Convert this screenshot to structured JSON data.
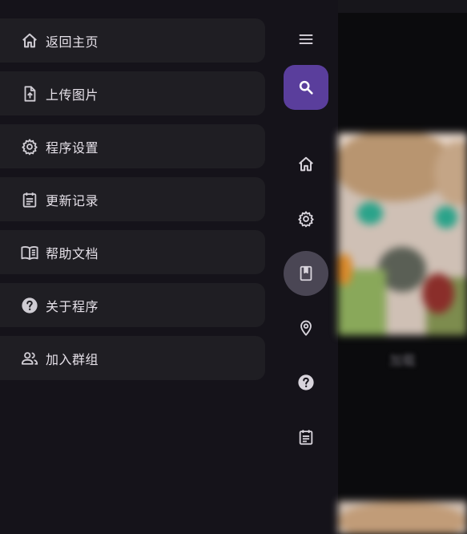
{
  "drawer": {
    "items": [
      {
        "label": "返回主页",
        "icon": "home-outline-icon"
      },
      {
        "label": "上传图片",
        "icon": "file-upload-icon"
      },
      {
        "label": "程序设置",
        "icon": "settings-gear-icon"
      },
      {
        "label": "更新记录",
        "icon": "calendar-list-icon"
      },
      {
        "label": "帮助文档",
        "icon": "book-open-icon"
      },
      {
        "label": "关于程序",
        "icon": "help-circle-icon"
      },
      {
        "label": "加入群组",
        "icon": "group-people-icon"
      }
    ]
  },
  "rail": {
    "items": [
      "menu-icon",
      "search-icon",
      "home-icon",
      "settings-gear-icon",
      "bookmark-book-icon",
      "location-pin-icon",
      "help-circle-icon",
      "calendar-list-icon"
    ],
    "accent": "#5a3e9c",
    "active_bg": "#4a4654"
  },
  "content": {
    "caption": "加载"
  }
}
